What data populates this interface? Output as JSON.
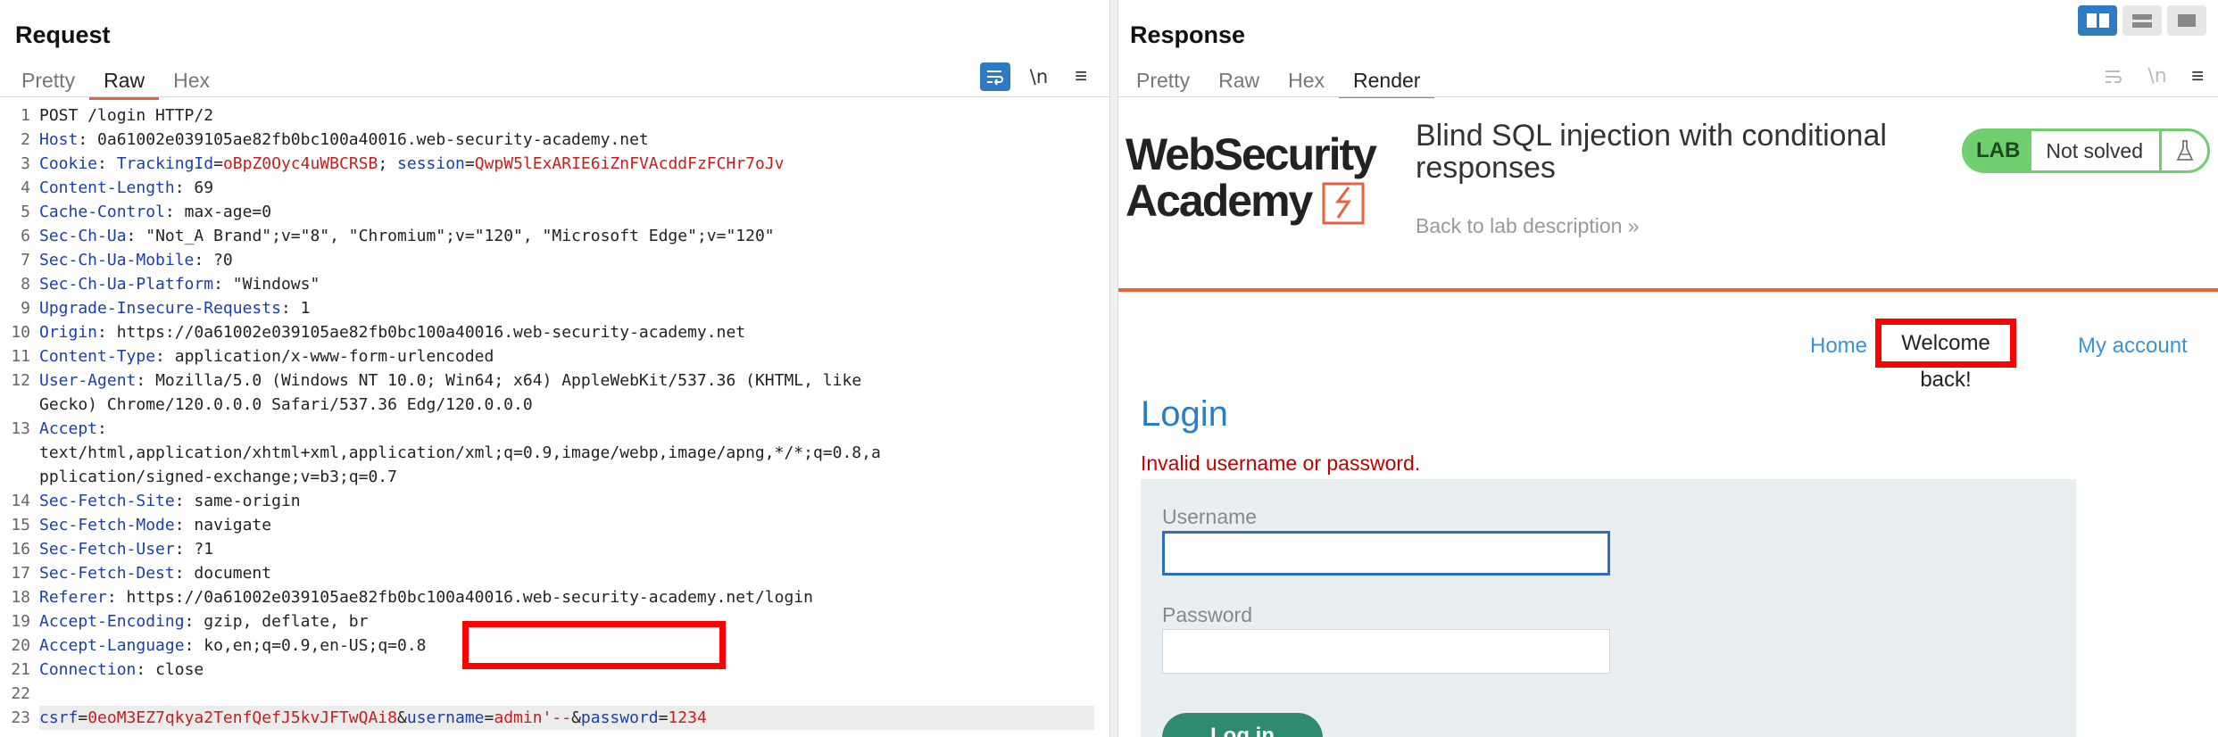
{
  "request": {
    "title": "Request",
    "tabs": [
      {
        "label": "Pretty",
        "active": false
      },
      {
        "label": "Raw",
        "active": true
      },
      {
        "label": "Hex",
        "active": false
      }
    ],
    "toolbar": {
      "wrap_icon": "wrap-lines-icon",
      "newline_label": "\\n",
      "menu_icon": "hamburger-menu-icon"
    },
    "lines": [
      {
        "n": "1",
        "type": "plain",
        "text": "POST /login HTTP/2"
      },
      {
        "n": "2",
        "type": "header",
        "key": "Host",
        "value": "0a61002e039105ae82fb0bc100a40016.web-security-academy.net"
      },
      {
        "n": "3",
        "type": "cookie",
        "key": "Cookie",
        "c1k": "TrackingId",
        "c1v": "oBpZ0Oyc4uWBCRSB",
        "c2k": "session",
        "c2v": "QwpW5lExARIE6iZnFVAcddFzFCHr7oJv"
      },
      {
        "n": "4",
        "type": "header",
        "key": "Content-Length",
        "value": "69"
      },
      {
        "n": "5",
        "type": "header",
        "key": "Cache-Control",
        "value": "max-age=0"
      },
      {
        "n": "6",
        "type": "header",
        "key": "Sec-Ch-Ua",
        "value": "\"Not_A Brand\";v=\"8\", \"Chromium\";v=\"120\", \"Microsoft Edge\";v=\"120\""
      },
      {
        "n": "7",
        "type": "header",
        "key": "Sec-Ch-Ua-Mobile",
        "value": "?0"
      },
      {
        "n": "8",
        "type": "header",
        "key": "Sec-Ch-Ua-Platform",
        "value": "\"Windows\""
      },
      {
        "n": "9",
        "type": "header",
        "key": "Upgrade-Insecure-Requests",
        "value": "1"
      },
      {
        "n": "10",
        "type": "header",
        "key": "Origin",
        "value": "https://0a61002e039105ae82fb0bc100a40016.web-security-academy.net"
      },
      {
        "n": "11",
        "type": "header",
        "key": "Content-Type",
        "value": "application/x-www-form-urlencoded"
      },
      {
        "n": "12",
        "type": "header",
        "key": "User-Agent",
        "value": "Mozilla/5.0 (Windows NT 10.0; Win64; x64) AppleWebKit/537.36 (KHTML, like",
        "cont": [
          "Gecko) Chrome/120.0.0.0 Safari/537.36 Edg/120.0.0.0"
        ]
      },
      {
        "n": "13",
        "type": "header",
        "key": "Accept",
        "value": "",
        "cont": [
          "text/html,application/xhtml+xml,application/xml;q=0.9,image/webp,image/apng,*/*;q=0.8,a",
          "pplication/signed-exchange;v=b3;q=0.7"
        ]
      },
      {
        "n": "14",
        "type": "header",
        "key": "Sec-Fetch-Site",
        "value": "same-origin"
      },
      {
        "n": "15",
        "type": "header",
        "key": "Sec-Fetch-Mode",
        "value": "navigate"
      },
      {
        "n": "16",
        "type": "header",
        "key": "Sec-Fetch-User",
        "value": "?1"
      },
      {
        "n": "17",
        "type": "header",
        "key": "Sec-Fetch-Dest",
        "value": "document"
      },
      {
        "n": "18",
        "type": "header",
        "key": "Referer",
        "value": "https://0a61002e039105ae82fb0bc100a40016.web-security-academy.net/login"
      },
      {
        "n": "19",
        "type": "header",
        "key": "Accept-Encoding",
        "value": "gzip, deflate, br"
      },
      {
        "n": "20",
        "type": "header",
        "key": "Accept-Language",
        "value": "ko,en;q=0.9,en-US;q=0.8"
      },
      {
        "n": "21",
        "type": "header",
        "key": "Connection",
        "value": "close"
      },
      {
        "n": "22",
        "type": "blank",
        "text": ""
      },
      {
        "n": "23",
        "type": "body",
        "params": [
          {
            "k": "csrf",
            "v": "0eoM3EZ7qkya2TenfQefJ5kvJFTwQAi8"
          },
          {
            "k": "username",
            "v": "admin'--"
          },
          {
            "k": "password",
            "v": "1234"
          }
        ]
      }
    ]
  },
  "response": {
    "title": "Response",
    "tabs": [
      {
        "label": "Pretty",
        "active": false
      },
      {
        "label": "Raw",
        "active": false
      },
      {
        "label": "Hex",
        "active": false
      },
      {
        "label": "Render",
        "active": true
      }
    ],
    "toolbar": {
      "wrap_icon": "wrap-lines-icon",
      "newline_label": "\\n",
      "menu_icon": "hamburger-menu-icon"
    },
    "view_toggles": [
      "split-horizontal-icon",
      "split-vertical-icon",
      "single-pane-icon"
    ],
    "render": {
      "logo": {
        "line1": "WebSecurity",
        "line2": "Academy"
      },
      "lab_title": "Blind SQL injection with conditional responses",
      "back_link": "Back to lab description »",
      "badge": {
        "lab": "LAB",
        "status": "Not solved",
        "icon": "flask-icon"
      },
      "nav": {
        "home": "Home",
        "welcome": "Welcome back!",
        "account": "My account"
      },
      "login": {
        "heading": "Login",
        "error": "Invalid username or password.",
        "username_label": "Username",
        "username_value": "",
        "password_label": "Password",
        "password_value": "",
        "button": "Log in"
      }
    }
  },
  "colors": {
    "accent": "#e8603c",
    "link": "#3a93d6",
    "highlight_box": "#ff0000",
    "badge_green": "#6fcf6f",
    "button_green": "#2f8a72"
  }
}
